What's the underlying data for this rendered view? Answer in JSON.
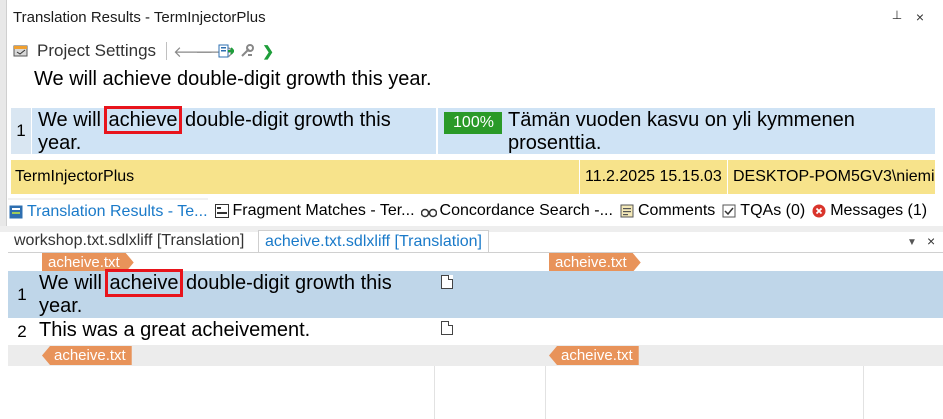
{
  "panel": {
    "title": "Translation Results - TermInjectorPlus",
    "pin_icon": "pin-icon",
    "close_icon": "close-icon",
    "pin_glyph": "⊥",
    "close_glyph": "×"
  },
  "toolbar": {
    "project_settings_label": "Project Settings",
    "icons": [
      "project-settings-icon",
      "previous-arrow-icon",
      "next-arrow-icon",
      "apply-translation-icon",
      "tools-icon",
      "green-next-icon"
    ]
  },
  "source_display": "We will achieve double-digit growth this year.",
  "result": {
    "number": "1",
    "source_before": "We will ",
    "source_highlight": "achieve",
    "source_after": " double-digit growth this year.",
    "match": "100%",
    "target": "Tämän vuoden kasvu on yli kymmenen prosenttia."
  },
  "meta": {
    "provider": "TermInjectorPlus",
    "date": "11.2.2025 15.15.03",
    "user": "DESKTOP-POM5GV3\\niemi"
  },
  "tabs": [
    {
      "label": "Translation Results - Te...",
      "icon": "translation-results-icon",
      "active": true
    },
    {
      "label": "Fragment Matches - Ter...",
      "icon": "fragment-matches-icon",
      "active": false
    },
    {
      "label": "Concordance Search -...",
      "icon": "concordance-search-icon",
      "active": false
    },
    {
      "label": "Comments",
      "icon": "comments-icon",
      "active": false
    },
    {
      "label": "TQAs (0)",
      "icon": "tqa-icon",
      "active": false
    },
    {
      "label": "Messages (1)",
      "icon": "messages-error-icon",
      "active": false
    }
  ],
  "doc_tabs": {
    "tab1": "workshop.txt.sdlxliff [Translation]",
    "tab2": "acheive.txt.sdlxliff [Translation]",
    "menu_glyph": "▼",
    "close_glyph": "×"
  },
  "editor": {
    "tag_name": "acheive.txt",
    "segments": [
      {
        "number": "1",
        "source_before": "We will ",
        "source_highlight": "acheive",
        "source_after": " double-digit growth this year."
      },
      {
        "number": "2",
        "source": "This was a great acheivement."
      }
    ]
  },
  "colors": {
    "selected_row": "#bfd6e9",
    "tag": "#e8935a",
    "match_badge": "#2a9a28",
    "meta_bar": "#f7e38b",
    "highlight_box": "#e8141c",
    "active_tab": "#1a7ac9"
  }
}
